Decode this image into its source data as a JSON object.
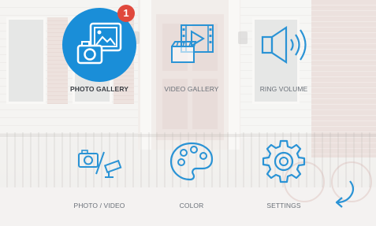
{
  "menu": {
    "items": [
      {
        "id": "photo-gallery",
        "label": "PHOTO GALLERY",
        "icon": "photo-gallery-icon",
        "badge": "1",
        "selected": true
      },
      {
        "id": "video-gallery",
        "label": "VIDEO GALLERY",
        "icon": "video-gallery-icon"
      },
      {
        "id": "ring-volume",
        "label": "RING VOLUME",
        "icon": "speaker-volume-icon"
      },
      {
        "id": "photo-video",
        "label": "PHOTO / VIDEO",
        "icon": "camera-cctv-icon"
      },
      {
        "id": "color",
        "label": "COLOR",
        "icon": "palette-icon"
      },
      {
        "id": "settings",
        "label": "SETTINGS",
        "icon": "gear-icon"
      }
    ]
  },
  "back": {
    "icon": "back-arrow-icon"
  },
  "colors": {
    "accent": "#1a8ed8",
    "badge": "#e0483c",
    "icon_stroke": "#2a93d5",
    "label": "#6a7078"
  }
}
